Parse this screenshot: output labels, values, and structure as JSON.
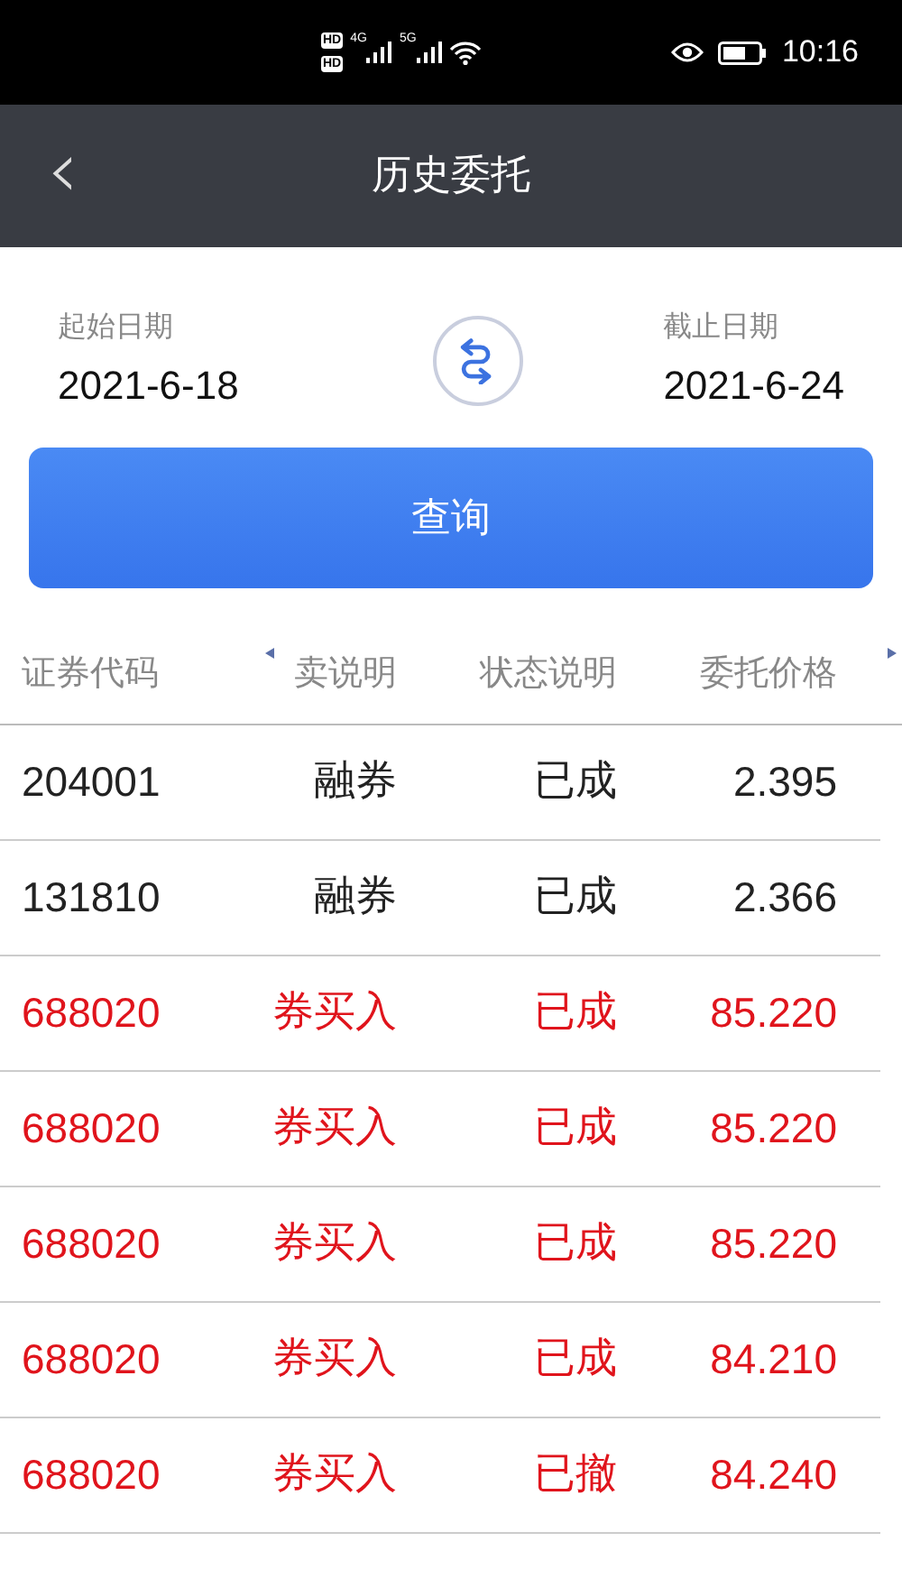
{
  "status_bar": {
    "hd_badges": [
      "HD",
      "HD"
    ],
    "networks": [
      "4G",
      "5G"
    ],
    "time": "10:16"
  },
  "header": {
    "back": "‹",
    "title": "历史委托"
  },
  "dates": {
    "start_label": "起始日期",
    "start": "2021-6-18",
    "end_label": "截止日期",
    "end": "2021-6-24"
  },
  "query_button": "查询",
  "table": {
    "columns": [
      "证券代码",
      "卖说明",
      "状态说明",
      "委托价格"
    ],
    "rows": [
      {
        "cells": [
          "204001",
          "融券",
          "已成",
          "2.395"
        ],
        "color": "#222222"
      },
      {
        "cells": [
          "131810",
          "融券",
          "已成",
          "2.366"
        ],
        "color": "#222222"
      },
      {
        "cells": [
          "688020",
          "券买入",
          "已成",
          "85.220"
        ],
        "color": "#e0141c"
      },
      {
        "cells": [
          "688020",
          "券买入",
          "已成",
          "85.220"
        ],
        "color": "#e0141c"
      },
      {
        "cells": [
          "688020",
          "券买入",
          "已成",
          "85.220"
        ],
        "color": "#e0141c"
      },
      {
        "cells": [
          "688020",
          "券买入",
          "已成",
          "84.210"
        ],
        "color": "#e0141c"
      },
      {
        "cells": [
          "688020",
          "券买入",
          "已撤",
          "84.240"
        ],
        "color": "#e0141c"
      }
    ]
  }
}
